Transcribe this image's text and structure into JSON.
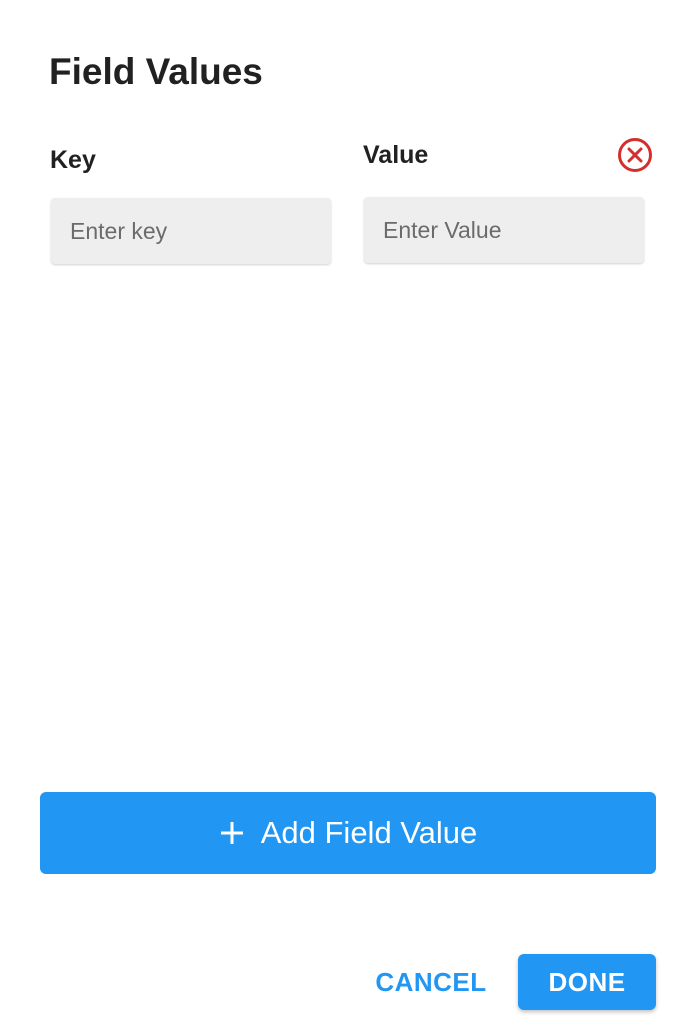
{
  "dialog": {
    "title": "Field Values"
  },
  "columns": {
    "key_label": "Key",
    "value_label": "Value"
  },
  "row": {
    "key": {
      "value": "",
      "placeholder": "Enter key"
    },
    "value": {
      "value": "",
      "placeholder": "Enter Value"
    },
    "remove_icon": "close-circle-icon"
  },
  "actions": {
    "add_label": "Add Field Value",
    "add_icon": "plus-icon",
    "cancel_label": "CANCEL",
    "done_label": "DONE"
  },
  "colors": {
    "primary": "#2196f3",
    "danger": "#d32f2f",
    "input_bg": "#eeeeee",
    "text": "#212121"
  }
}
